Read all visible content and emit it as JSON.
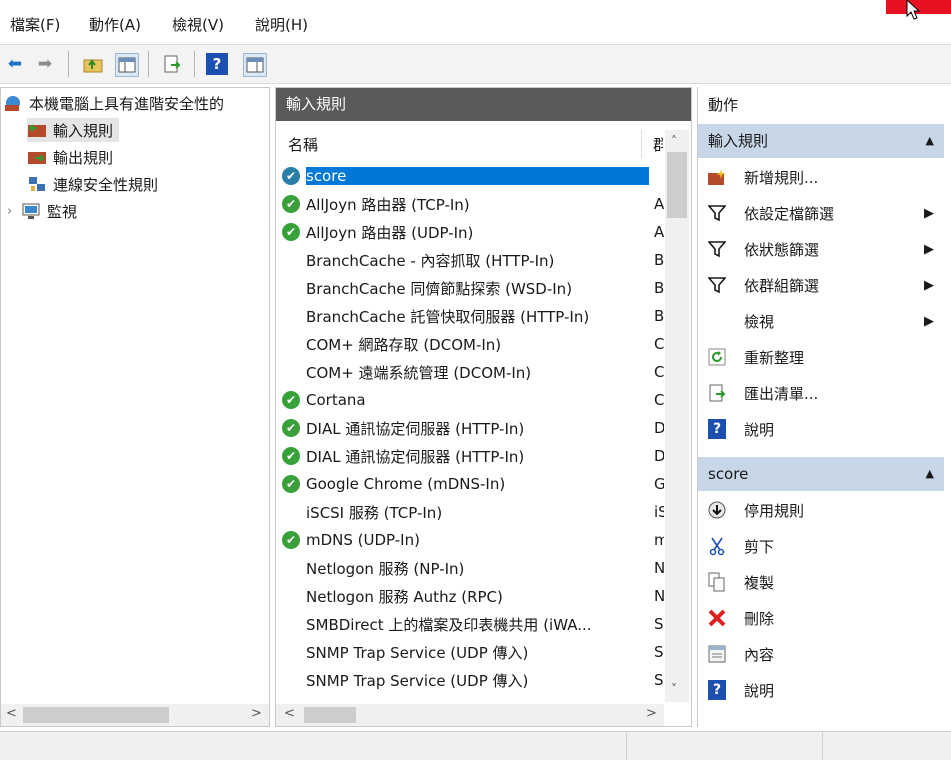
{
  "menu": {
    "file": "檔案(F)",
    "action": "動作(A)",
    "view": "檢視(V)",
    "help": "說明(H)"
  },
  "tree": {
    "root": "本機電腦上具有進階安全性的",
    "items": [
      {
        "label": "輸入規則",
        "selected": true
      },
      {
        "label": "輸出規則"
      },
      {
        "label": "連線安全性規則"
      },
      {
        "label": "監視"
      }
    ]
  },
  "middle": {
    "title": "輸入規則",
    "col_name": "名稱",
    "col_group": "群",
    "rows": [
      {
        "name": "score",
        "group": "",
        "enabled": true,
        "selected": true
      },
      {
        "name": "AllJoyn 路由器 (TCP-In)",
        "group": "A",
        "enabled": true
      },
      {
        "name": "AllJoyn 路由器 (UDP-In)",
        "group": "A",
        "enabled": true
      },
      {
        "name": "BranchCache - 內容抓取 (HTTP-In)",
        "group": "B",
        "enabled": false
      },
      {
        "name": "BranchCache 同儕節點探索 (WSD-In)",
        "group": "B",
        "enabled": false
      },
      {
        "name": "BranchCache 託管快取伺服器 (HTTP-In)",
        "group": "B",
        "enabled": false
      },
      {
        "name": "COM+ 網路存取 (DCOM-In)",
        "group": "C",
        "enabled": false
      },
      {
        "name": "COM+ 遠端系統管理 (DCOM-In)",
        "group": "C",
        "enabled": false
      },
      {
        "name": "Cortana",
        "group": "C",
        "enabled": true
      },
      {
        "name": "DIAL 通訊協定伺服器 (HTTP-In)",
        "group": "D",
        "enabled": true
      },
      {
        "name": "DIAL 通訊協定伺服器 (HTTP-In)",
        "group": "D",
        "enabled": true
      },
      {
        "name": "Google Chrome (mDNS-In)",
        "group": "G",
        "enabled": true
      },
      {
        "name": "iSCSI 服務 (TCP-In)",
        "group": "iS",
        "enabled": false
      },
      {
        "name": "mDNS (UDP-In)",
        "group": "m",
        "enabled": true
      },
      {
        "name": "Netlogon 服務 (NP-In)",
        "group": "N",
        "enabled": false
      },
      {
        "name": "Netlogon 服務 Authz (RPC)",
        "group": "N",
        "enabled": false
      },
      {
        "name": "SMBDirect 上的檔案及印表機共用 (iWA...",
        "group": "S",
        "enabled": false
      },
      {
        "name": "SNMP Trap Service (UDP 傳入)",
        "group": "S",
        "enabled": false
      },
      {
        "name": "SNMP Trap Service (UDP 傳入)",
        "group": "S",
        "enabled": false
      }
    ]
  },
  "actions": {
    "title": "動作",
    "section1": "輸入規則",
    "items1": [
      {
        "label": "新增規則...",
        "icon": "new-rule-icon",
        "submenu": false
      },
      {
        "label": "依設定檔篩選",
        "icon": "filter-icon",
        "submenu": true
      },
      {
        "label": "依狀態篩選",
        "icon": "filter-icon",
        "submenu": true
      },
      {
        "label": "依群組篩選",
        "icon": "filter-icon",
        "submenu": true
      },
      {
        "label": "檢視",
        "icon": "",
        "submenu": true
      },
      {
        "label": "重新整理",
        "icon": "refresh-icon",
        "submenu": false
      },
      {
        "label": "匯出清單...",
        "icon": "export-icon",
        "submenu": false
      },
      {
        "label": "說明",
        "icon": "help-icon",
        "submenu": false
      }
    ],
    "section2": "score",
    "items2": [
      {
        "label": "停用規則",
        "icon": "disable-icon"
      },
      {
        "label": "剪下",
        "icon": "cut-icon"
      },
      {
        "label": "複製",
        "icon": "copy-icon"
      },
      {
        "label": "刪除",
        "icon": "delete-icon"
      },
      {
        "label": "內容",
        "icon": "properties-icon"
      },
      {
        "label": "說明",
        "icon": "help-icon"
      }
    ]
  }
}
